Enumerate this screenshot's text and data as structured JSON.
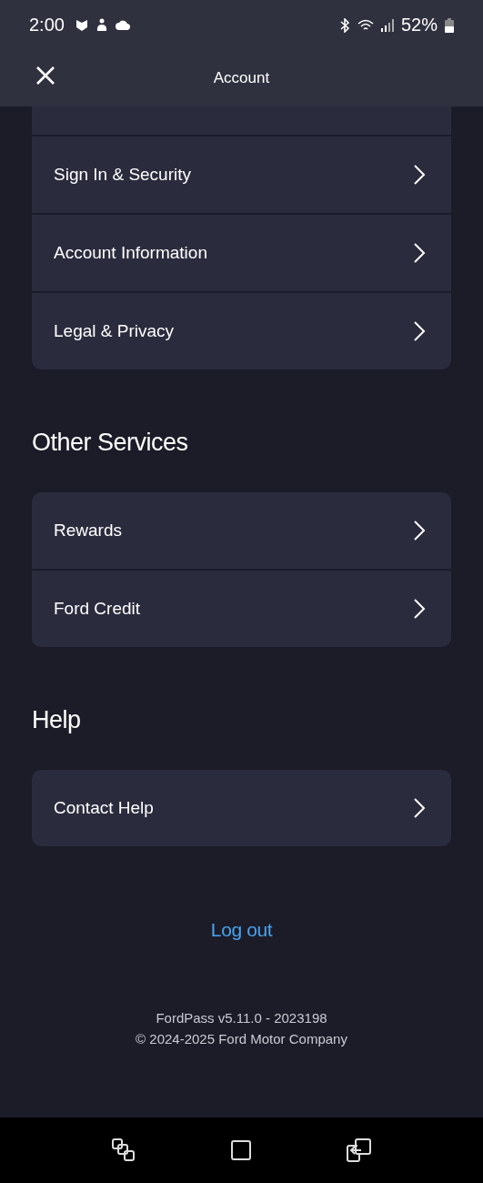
{
  "status_bar": {
    "time": "2:00",
    "battery": "52%"
  },
  "header": {
    "title": "Account"
  },
  "sections": [
    {
      "cut_top": true,
      "items": [
        {
          "label": "Sign In & Security"
        },
        {
          "label": "Account Information"
        },
        {
          "label": "Legal & Privacy"
        }
      ]
    },
    {
      "heading": "Other Services",
      "items": [
        {
          "label": "Rewards"
        },
        {
          "label": "Ford Credit"
        }
      ]
    },
    {
      "heading": "Help",
      "items": [
        {
          "label": "Contact Help"
        }
      ]
    }
  ],
  "logout": "Log out",
  "footer": [
    "FordPass v5.11.0 - 2023198",
    "© 2024-2025 Ford Motor Company"
  ]
}
